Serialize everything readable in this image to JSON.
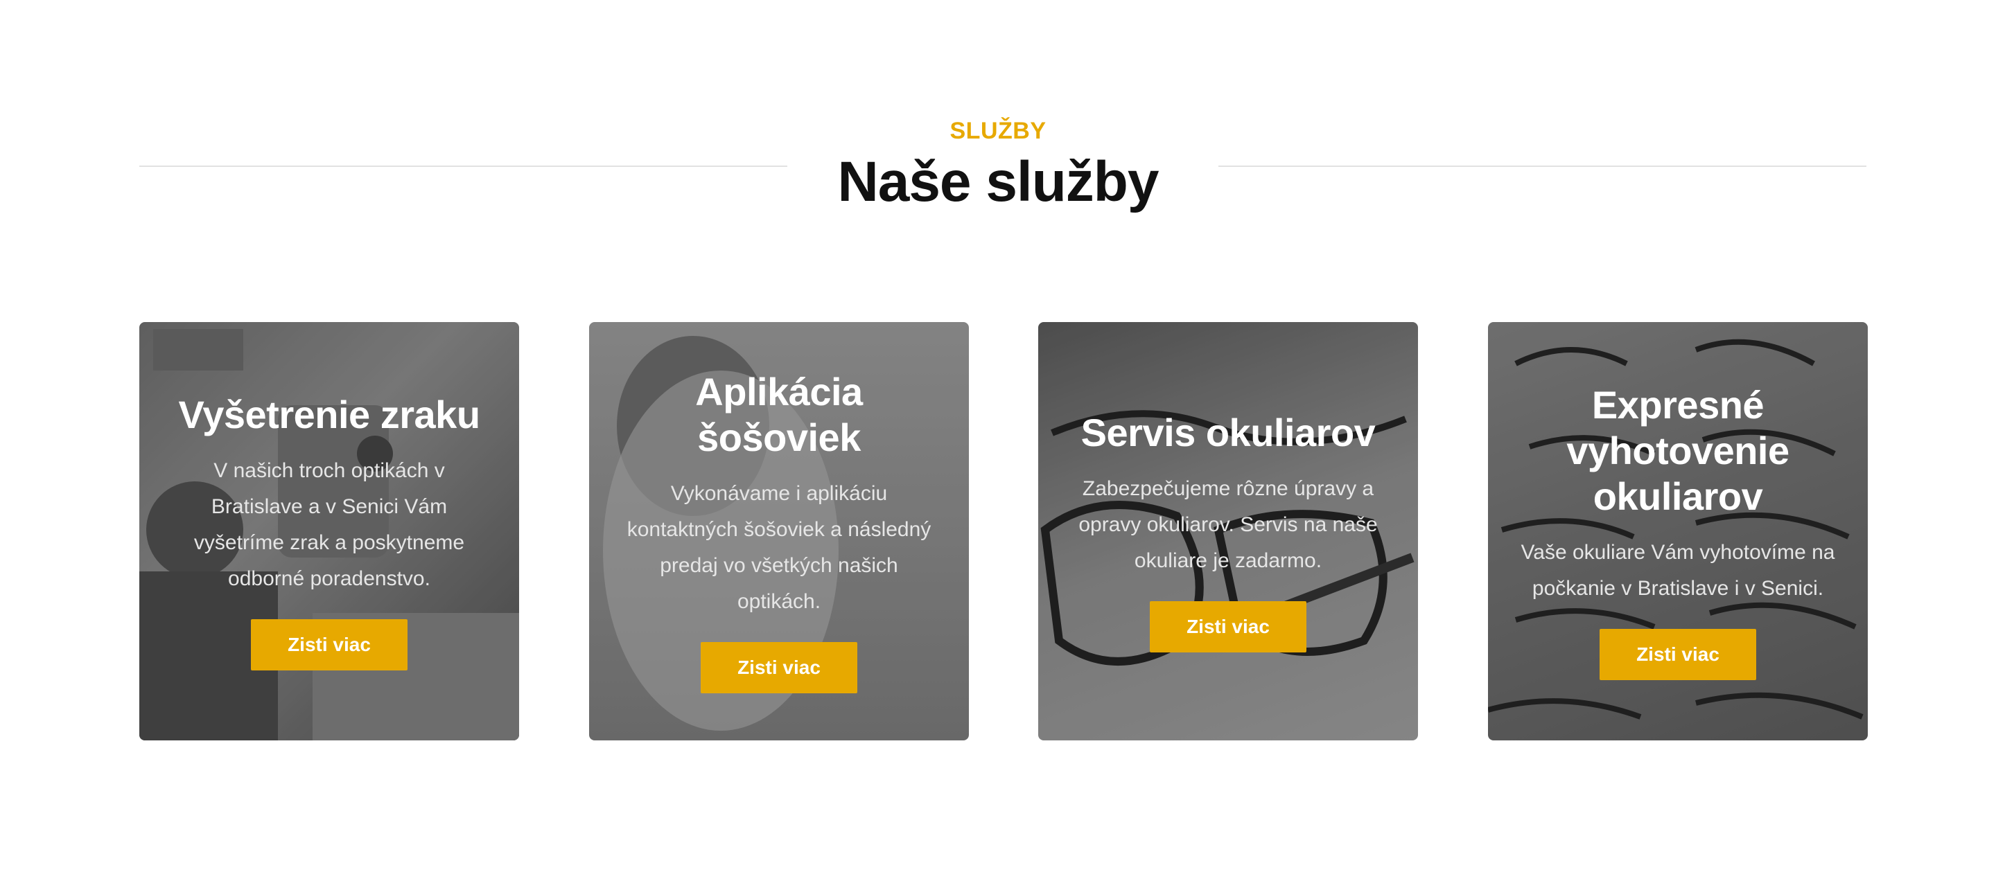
{
  "section": {
    "eyebrow": "SLUŽBY",
    "title": "Naše služby"
  },
  "cards": [
    {
      "title": "Vyšetrenie zraku",
      "text": "V našich troch optikách v Bratislave a v Senici Vám vyšetríme zrak a poskytneme odborné poradenstvo.",
      "button": "Zisti viac"
    },
    {
      "title": "Aplikácia šošoviek",
      "text": "Vykonávame i aplikáciu kontaktných šošoviek a následný predaj vo všetkých našich optikách.",
      "button": "Zisti viac"
    },
    {
      "title": "Servis okuliarov",
      "text": "Zabezpečujeme rôzne úpravy a opravy okuliarov. Servis na naše okuliare je zadarmo.",
      "button": "Zisti viac"
    },
    {
      "title": "Expresné vyhotovenie okuliarov",
      "text": "Vaše okuliare Vám vyhotovíme na počkanie v Bratislave i v Senici.",
      "button": "Zisti viac"
    }
  ],
  "colors": {
    "accent": "#e7a900",
    "heading": "#111111",
    "divider": "#e2e2e2"
  }
}
